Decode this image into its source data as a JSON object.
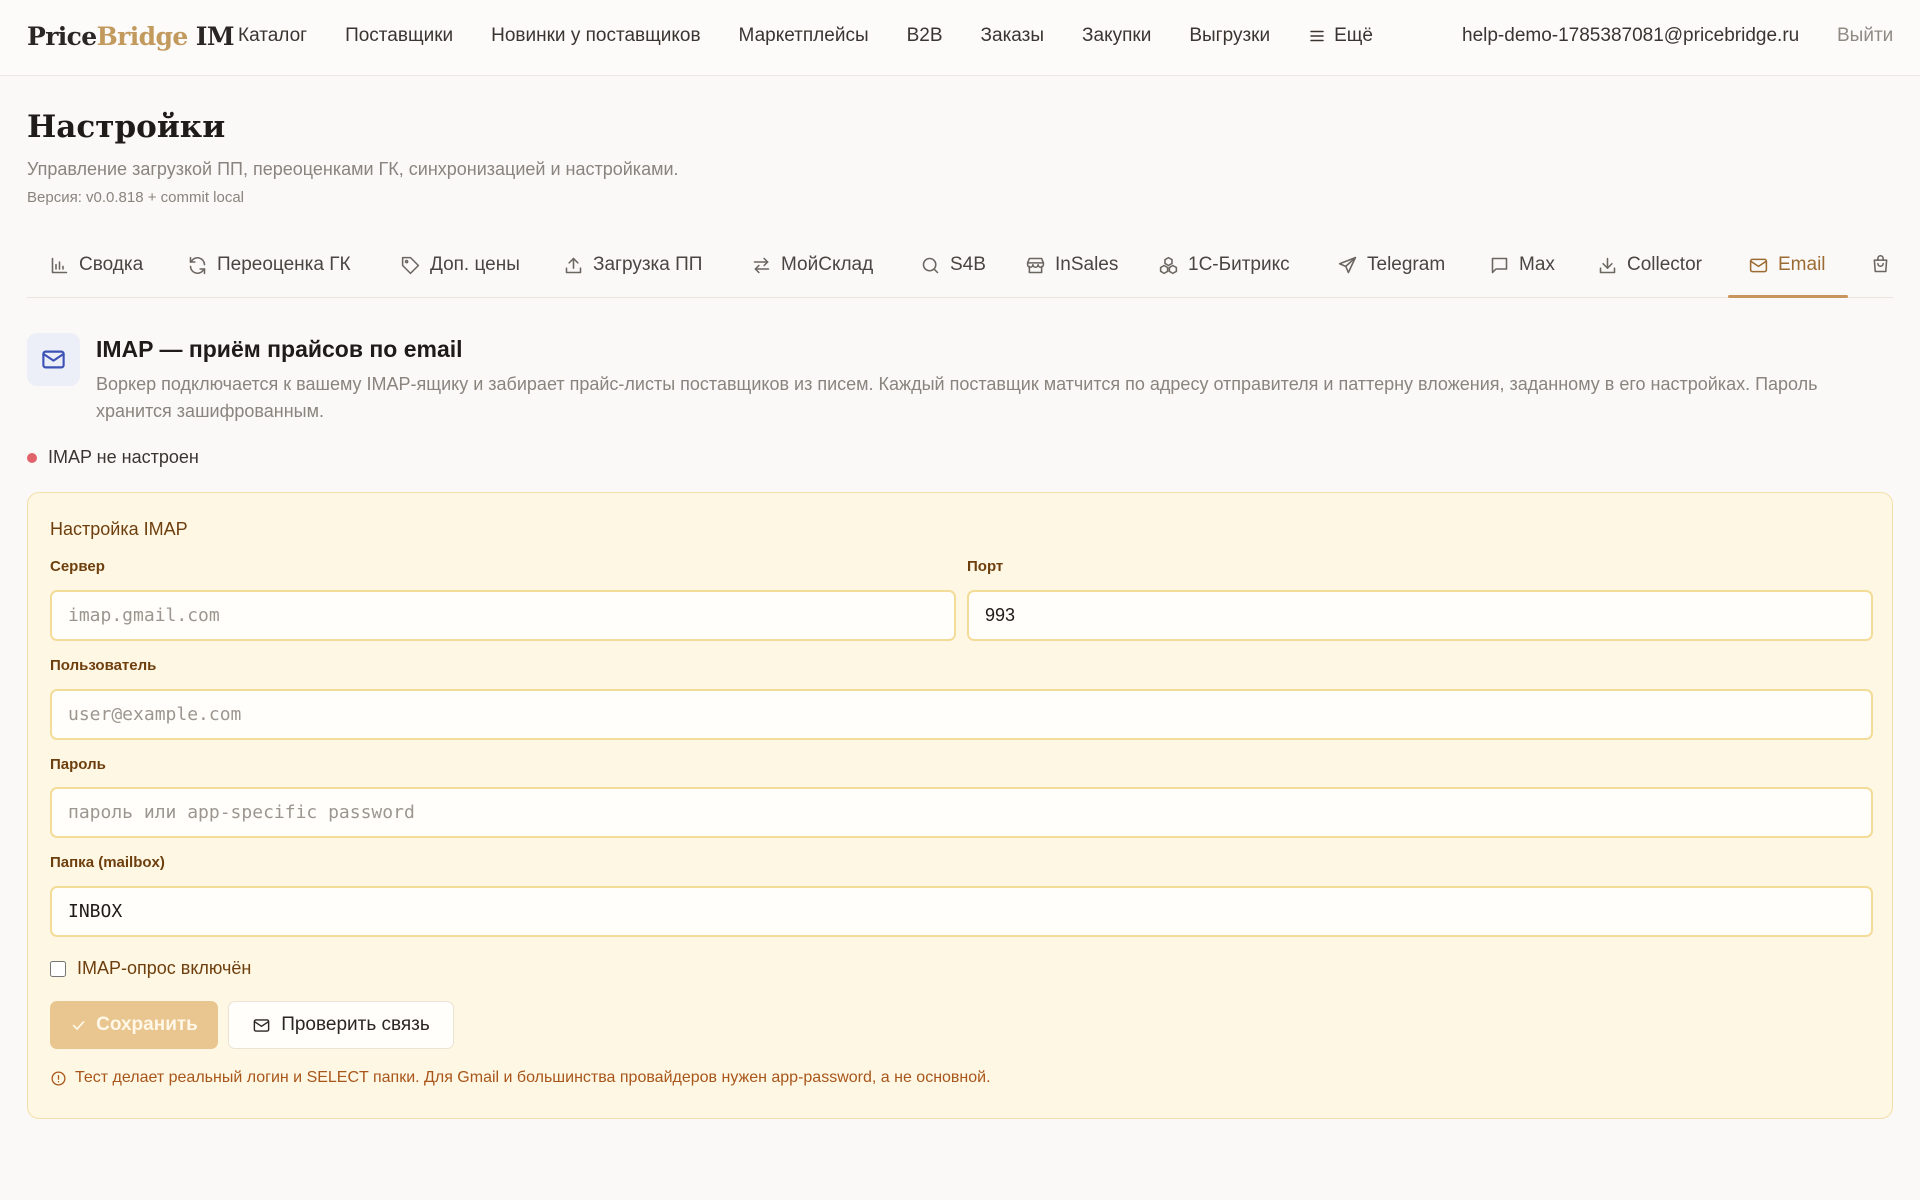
{
  "header": {
    "logo_part1": "Price",
    "logo_part2": "Bridge",
    "logo_part3": " IM",
    "nav": [
      "Каталог",
      "Поставщики",
      "Новинки у поставщиков",
      "Маркетплейсы",
      "B2B",
      "Заказы",
      "Закупки",
      "Выгрузки",
      "Ещё"
    ],
    "nav_more_icon": "menu-icon",
    "user_email": "help-demo-1785387081@pricebridge.ru",
    "logout": "Выйти"
  },
  "page": {
    "title": "Настройки",
    "subtitle": "Управление загрузкой ПП, переоценками ГК, синхронизацией и настройками.",
    "version": "Версия: v0.0.818 + commit local"
  },
  "tabs": [
    {
      "label": "Сводка",
      "icon": "bar-chart-icon"
    },
    {
      "label": "Переоценка ГК",
      "icon": "refresh-icon"
    },
    {
      "label": "Доп. цены",
      "icon": "tag-icon"
    },
    {
      "label": "Загрузка ПП",
      "icon": "upload-icon"
    },
    {
      "label": "МойСклад",
      "icon": "swap-icon"
    },
    {
      "label": "S4B",
      "icon": "search-icon"
    },
    {
      "label": "InSales",
      "icon": "store-icon"
    },
    {
      "label": "1С-Битрикс",
      "icon": "cubes-icon"
    },
    {
      "label": "Telegram",
      "icon": "send-icon"
    },
    {
      "label": "Max",
      "icon": "message-icon"
    },
    {
      "label": "Collector",
      "icon": "download-icon"
    },
    {
      "label": "Email",
      "icon": "mail-icon",
      "active": true
    },
    {
      "label": "",
      "icon": "shopping-bag-icon"
    }
  ],
  "section": {
    "title": "IMAP — приём прайсов по email",
    "description": "Воркер подключается к вашему IMAP-ящику и забирает прайс-листы поставщиков из писем. Каждый поставщик матчится по адресу отправителя и паттерну вложения, заданному в его настройках. Пароль хранится зашифрованным.",
    "status": "IMAP не настроен",
    "status_color": "#e0636b"
  },
  "imap": {
    "card_title": "Настройка IMAP",
    "server_label": "Сервер",
    "server_value": "",
    "server_placeholder": "imap.gmail.com",
    "port_label": "Порт",
    "port_value": "993",
    "user_label": "Пользователь",
    "user_value": "",
    "user_placeholder": "user@example.com",
    "password_label": "Пароль",
    "password_value": "",
    "password_placeholder": "пароль или app-specific password",
    "folder_label": "Папка (mailbox)",
    "folder_value": "INBOX",
    "polling_label": "IMAP-опрос включён",
    "polling_enabled": false,
    "save_label": "Сохранить",
    "test_label": "Проверить связь",
    "hint": "Тест делает реальный логин и SELECT папки. Для Gmail и большинства провайдеров нужен app-password, а не основной."
  },
  "colors": {
    "accent": "#c8955c",
    "card_bg": "#fef7e3",
    "card_border": "#f2dfa9",
    "label": "#6e3f0e",
    "hint": "#a8561b"
  }
}
